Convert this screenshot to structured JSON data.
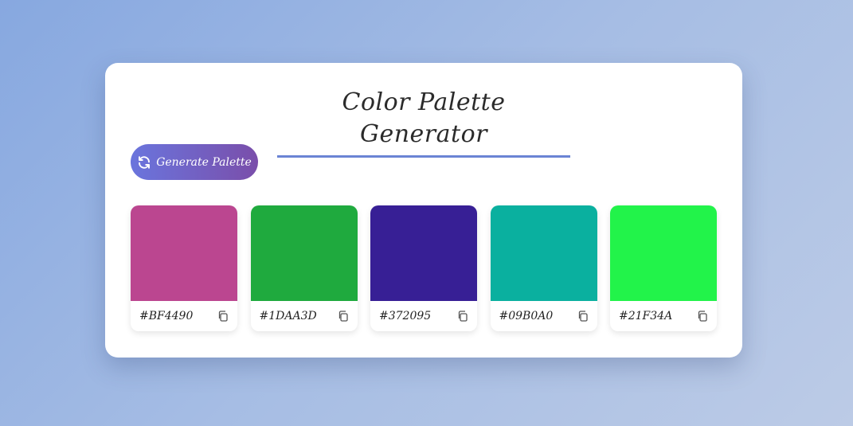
{
  "app": {
    "title": "Color Palette Generator"
  },
  "toolbar": {
    "generate_label": "Generate Palette",
    "generate_icon": "refresh-icon"
  },
  "palette": [
    {
      "hex": "#BF4490",
      "color": "#BB4690",
      "copy_icon": "copy-icon"
    },
    {
      "hex": "#1DAA3D",
      "color": "#1FAA3E",
      "copy_icon": "copy-icon"
    },
    {
      "hex": "#372095",
      "color": "#371F95",
      "copy_icon": "copy-icon"
    },
    {
      "hex": "#09B0A0",
      "color": "#0AB09F",
      "copy_icon": "copy-icon"
    },
    {
      "hex": "#21F34A",
      "color": "#22F34A",
      "copy_icon": "copy-icon"
    }
  ],
  "theme": {
    "accent": "#6B84D4",
    "button_start": "#6A75DD",
    "button_end": "#7A4EAA"
  }
}
